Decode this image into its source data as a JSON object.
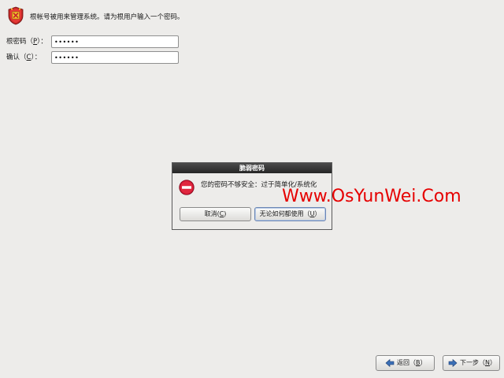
{
  "header": {
    "icon": "root-shield-icon",
    "text": "根帐号被用来管理系统。请为根用户输入一个密码。"
  },
  "form": {
    "root_password_label": "根密码（",
    "root_password_mnemonic": "P",
    "root_password_suffix": "）：",
    "root_password_value": "••••••",
    "confirm_label": "确认（",
    "confirm_mnemonic": "C",
    "confirm_suffix": "）：",
    "confirm_value": "••••••"
  },
  "dialog": {
    "title": "脆弱密码",
    "icon": "error-stop-icon",
    "message": "您的密码不够安全：过于简单化/系统化",
    "cancel_label": "取消(",
    "cancel_mnemonic": "C",
    "cancel_suffix": ")",
    "use_anyway_label": "无论如何都使用（",
    "use_anyway_mnemonic": "U",
    "use_anyway_suffix": "）"
  },
  "watermark": "Www.OsYunWei.Com",
  "nav": {
    "back_label": "返回（",
    "back_mnemonic": "B",
    "back_suffix": "）",
    "back_icon": "arrow-left-icon",
    "next_label": "下一步（",
    "next_mnemonic": "N",
    "next_suffix": "）",
    "next_icon": "arrow-right-icon"
  },
  "colors": {
    "background": "#edecea",
    "dialog_titlebar": "#333333",
    "error_red": "#c8102e",
    "watermark_red": "#e60000",
    "shield_red": "#c62828",
    "shield_gold": "#f2c12e",
    "nav_arrow_blue": "#3b6fb6"
  }
}
